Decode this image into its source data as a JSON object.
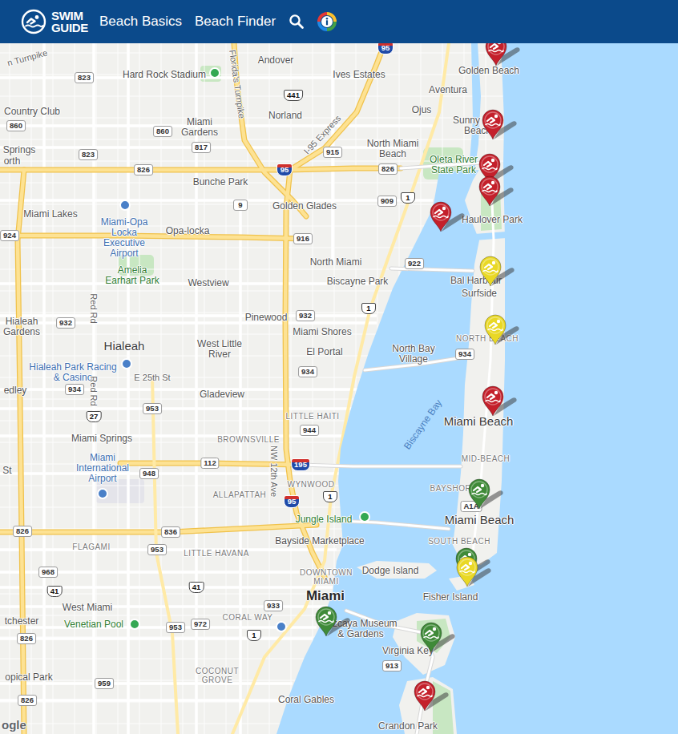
{
  "header": {
    "logo": [
      "SWIM",
      "GUIDE"
    ],
    "nav": [
      "Beach Basics",
      "Beach Finder"
    ]
  },
  "map": {
    "labels": [
      {
        "text": "Andover",
        "kind": "place"
      },
      {
        "text": "Ives Estates",
        "kind": "place"
      },
      {
        "text": "Golden Beach",
        "kind": "place"
      },
      {
        "text": "Aventura",
        "kind": "place"
      },
      {
        "text": "Ojus",
        "kind": "place"
      },
      {
        "text": "Country Club",
        "kind": "place"
      },
      {
        "text": "Hard Rock Stadium",
        "kind": "poi"
      },
      {
        "text": "Miami Gardens",
        "kind": "place"
      },
      {
        "text": "Norland",
        "kind": "place"
      },
      {
        "text": "Sunny Isles Beach",
        "kind": "place"
      },
      {
        "text": "North Miami Beach",
        "kind": "place"
      },
      {
        "text": "Oleta River State Park",
        "kind": "park"
      },
      {
        "text": "Springs",
        "kind": "place"
      },
      {
        "text": "orth",
        "kind": "place"
      },
      {
        "text": "Bunche Park",
        "kind": "place"
      },
      {
        "text": "Golden Glades",
        "kind": "place"
      },
      {
        "text": "Miami Lakes",
        "kind": "place"
      },
      {
        "text": "Haulover Park",
        "kind": "place"
      },
      {
        "text": "Opa-locka",
        "kind": "place"
      },
      {
        "text": "Miami-Opa Locka Executive Airport",
        "kind": "transit"
      },
      {
        "text": "Amelia Earhart Park",
        "kind": "park"
      },
      {
        "text": "North Miami",
        "kind": "place"
      },
      {
        "text": "Biscayne Park",
        "kind": "place"
      },
      {
        "text": "Westview",
        "kind": "place"
      },
      {
        "text": "Bal Harbour",
        "kind": "place"
      },
      {
        "text": "Surfside",
        "kind": "place"
      },
      {
        "text": "Pinewood",
        "kind": "place"
      },
      {
        "text": "Miami Shores",
        "kind": "place"
      },
      {
        "text": "Hialeah Gardens",
        "kind": "place"
      },
      {
        "text": "Hialeah",
        "kind": "city"
      },
      {
        "text": "West Little River",
        "kind": "place"
      },
      {
        "text": "El Portal",
        "kind": "place"
      },
      {
        "text": "NORTH BEACH",
        "kind": "hood"
      },
      {
        "text": "North Bay Village",
        "kind": "place"
      },
      {
        "text": "Hialeah Park Racing & Casino",
        "kind": "transit"
      },
      {
        "text": "E 25th St",
        "kind": "road"
      },
      {
        "text": "edley",
        "kind": "place"
      },
      {
        "text": "Gladeview",
        "kind": "place"
      },
      {
        "text": "LITTLE HAITI",
        "kind": "hood"
      },
      {
        "text": "Miami Beach",
        "kind": "city"
      },
      {
        "text": "Biscayne Bay",
        "kind": "water"
      },
      {
        "text": "BROWNSVILLE",
        "kind": "hood"
      },
      {
        "text": "Miami Springs",
        "kind": "place"
      },
      {
        "text": "MID-BEACH",
        "kind": "hood"
      },
      {
        "text": "Miami International Airport",
        "kind": "transit"
      },
      {
        "text": "St",
        "kind": "place"
      },
      {
        "text": "WYNWOOD",
        "kind": "hood"
      },
      {
        "text": "BAYSHORE",
        "kind": "hood"
      },
      {
        "text": "ALLAPATTAH",
        "kind": "hood"
      },
      {
        "text": "Jungle Island",
        "kind": "park"
      },
      {
        "text": "Miami Beach",
        "kind": "city"
      },
      {
        "text": "Bayside Marketplace",
        "kind": "poi"
      },
      {
        "text": "SOUTH BEACH",
        "kind": "hood"
      },
      {
        "text": "LITTLE HAVANA",
        "kind": "hood"
      },
      {
        "text": "FLAGAMI",
        "kind": "hood"
      },
      {
        "text": "Dodge Island",
        "kind": "place"
      },
      {
        "text": "DOWNTOWN MIAMI",
        "kind": "hood"
      },
      {
        "text": "Miami",
        "kind": "capital"
      },
      {
        "text": "West Miami",
        "kind": "place"
      },
      {
        "text": "Fisher Island",
        "kind": "place"
      },
      {
        "text": "tchester",
        "kind": "place"
      },
      {
        "text": "Venetian Pool",
        "kind": "park"
      },
      {
        "text": "CORAL WAY",
        "kind": "hood"
      },
      {
        "text": "Vizcaya Museum & Gardens",
        "kind": "poi"
      },
      {
        "text": "Virginia Key",
        "kind": "place"
      },
      {
        "text": "COCONUT GROVE",
        "kind": "hood"
      },
      {
        "text": "opical Park",
        "kind": "place"
      },
      {
        "text": "Coral Gables",
        "kind": "place"
      },
      {
        "text": "Crandon Park",
        "kind": "place"
      },
      {
        "text": "Florida's Turnpike",
        "kind": "road"
      },
      {
        "text": "I-95 Express",
        "kind": "road"
      },
      {
        "text": "Red Rd",
        "kind": "road"
      },
      {
        "text": "Red Rd",
        "kind": "road"
      },
      {
        "text": "NW 12th Ave",
        "kind": "road"
      },
      {
        "text": "n Turnpike",
        "kind": "road"
      }
    ],
    "shields": [
      {
        "text": "95",
        "kind": "interstate"
      },
      {
        "text": "823",
        "kind": "state"
      },
      {
        "text": "441",
        "kind": "us"
      },
      {
        "text": "860",
        "kind": "state"
      },
      {
        "text": "860",
        "kind": "state"
      },
      {
        "text": "817",
        "kind": "state"
      },
      {
        "text": "823",
        "kind": "state"
      },
      {
        "text": "826",
        "kind": "state"
      },
      {
        "text": "95",
        "kind": "interstate"
      },
      {
        "text": "915",
        "kind": "state"
      },
      {
        "text": "826",
        "kind": "state"
      },
      {
        "text": "9",
        "kind": "state"
      },
      {
        "text": "909",
        "kind": "state"
      },
      {
        "text": "1",
        "kind": "us"
      },
      {
        "text": "916",
        "kind": "state"
      },
      {
        "text": "924",
        "kind": "state"
      },
      {
        "text": "922",
        "kind": "state"
      },
      {
        "text": "932",
        "kind": "state"
      },
      {
        "text": "932",
        "kind": "state"
      },
      {
        "text": "1",
        "kind": "us"
      },
      {
        "text": "934",
        "kind": "state"
      },
      {
        "text": "934",
        "kind": "state"
      },
      {
        "text": "934",
        "kind": "state"
      },
      {
        "text": "27",
        "kind": "us"
      },
      {
        "text": "953",
        "kind": "state"
      },
      {
        "text": "944",
        "kind": "state"
      },
      {
        "text": "195",
        "kind": "interstate"
      },
      {
        "text": "112",
        "kind": "state"
      },
      {
        "text": "948",
        "kind": "state"
      },
      {
        "text": "95",
        "kind": "interstate"
      },
      {
        "text": "1",
        "kind": "us"
      },
      {
        "text": "A1A",
        "kind": "state"
      },
      {
        "text": "836",
        "kind": "state"
      },
      {
        "text": "826",
        "kind": "state"
      },
      {
        "text": "953",
        "kind": "state"
      },
      {
        "text": "968",
        "kind": "state"
      },
      {
        "text": "41",
        "kind": "us"
      },
      {
        "text": "41",
        "kind": "us"
      },
      {
        "text": "933",
        "kind": "state"
      },
      {
        "text": "953",
        "kind": "state"
      },
      {
        "text": "972",
        "kind": "state"
      },
      {
        "text": "1",
        "kind": "us"
      },
      {
        "text": "826",
        "kind": "state"
      },
      {
        "text": "913",
        "kind": "state"
      },
      {
        "text": "959",
        "kind": "state"
      },
      {
        "text": "826",
        "kind": "state"
      }
    ],
    "pins": [
      {
        "color": "#c4202b"
      },
      {
        "color": "#c4202b"
      },
      {
        "color": "#c4202b"
      },
      {
        "color": "#c4202b"
      },
      {
        "color": "#c4202b"
      },
      {
        "color": "#e9d825"
      },
      {
        "color": "#e9d825"
      },
      {
        "color": "#c4202b"
      },
      {
        "color": "#3f8a38"
      },
      {
        "color": "#3f8a38"
      },
      {
        "color": "#e9d825"
      },
      {
        "color": "#3f8a38"
      },
      {
        "color": "#3f8a38"
      },
      {
        "color": "#c4202b"
      }
    ],
    "attribution": "ogle"
  }
}
